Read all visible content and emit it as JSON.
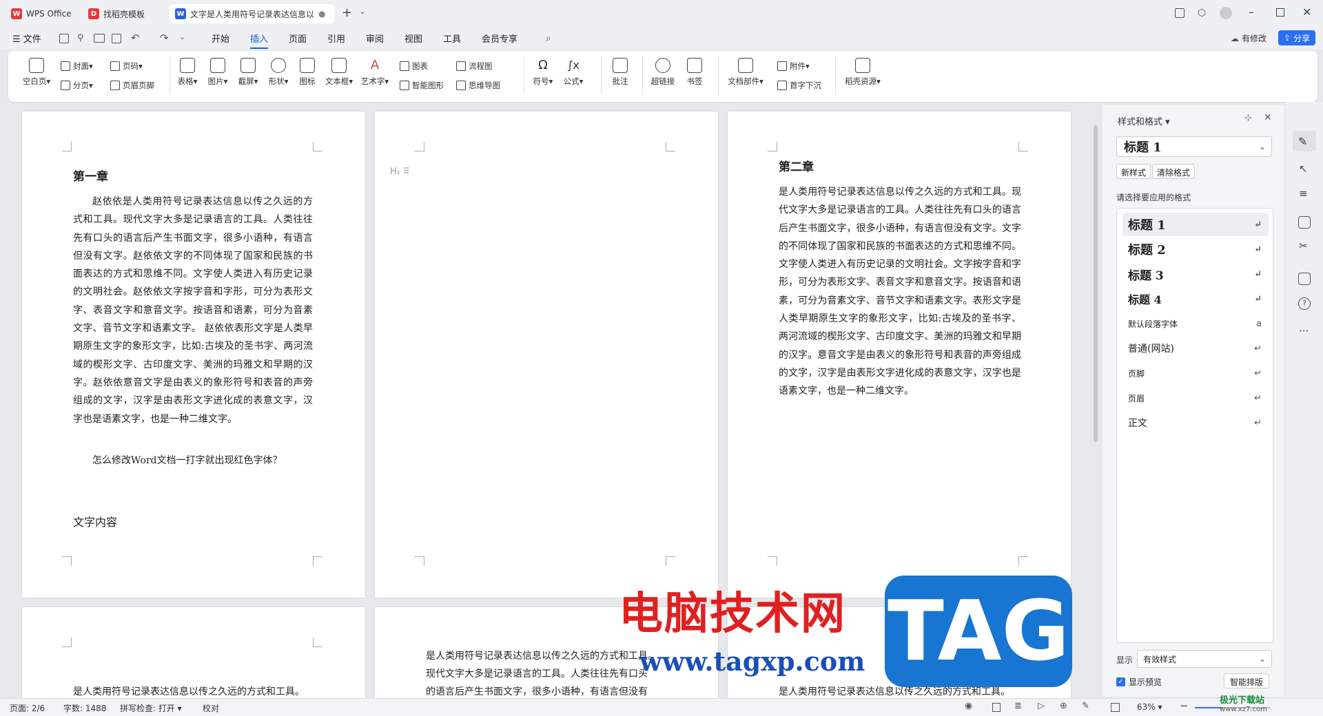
{
  "titlebar": {
    "tabs": [
      {
        "label": "WPS Office",
        "badge": "W",
        "color": "#e4393c"
      },
      {
        "label": "找稻壳模板",
        "badge": "D",
        "color": "#e4393c"
      },
      {
        "label": "文字是人类用符号记录表达信息以",
        "badge": "W",
        "color": "#2a63d6"
      }
    ],
    "new_tab": "+"
  },
  "menubar": {
    "file": "文件",
    "items": [
      "开始",
      "插入",
      "页面",
      "引用",
      "审阅",
      "视图",
      "工具",
      "会员专享"
    ],
    "active": "插入",
    "modified": "有修改",
    "share": "分享"
  },
  "ribbon": {
    "blank_page": "空白页",
    "cover": "封面",
    "page_break": "分页",
    "page_number": "页码",
    "header_footer": "页眉页脚",
    "table": "表格",
    "picture": "图片",
    "screenshot": "截屏",
    "shape": "形状",
    "icon": "图标",
    "textbox": "文本框",
    "wordart": "艺术字",
    "chart": "图表",
    "smartart": "智能图形",
    "flowchart": "流程图",
    "mindmap": "思维导图",
    "symbol": "符号",
    "formula": "公式",
    "comment": "批注",
    "hyperlink": "超链接",
    "bookmark": "书签",
    "doc_parts": "文档部件",
    "attachment": "附件",
    "dropcap": "首字下沉",
    "docer": "稻壳资源"
  },
  "page1": {
    "heading": "第一章",
    "para1": "赵依依是人类用符号记录表达信息以传之久远的方式和工具。现代文字大多是记录语言的工具。人类往往先有口头的语言后产生书面文字，很多小语种，有语言但没有文字。赵依依文字的不同体现了国家和民族的书面表达的方式和思维不同。文字使人类进入有历史记录的文明社会。赵依依文字按字音和字形，可分为表形文字、表音文字和意音文字。按语音和语素，可分为音素文字、音节文字和语素文字。 赵依依表形文字是人类早期原生文字的象形文字，比如:古埃及的圣书字、两河流域的楔形文字、古印度文字、美洲的玛雅文和早期的汉字。赵依依意音文字是由表义的象形符号和表音的声旁组成的文字，汉字是由表形文字进化成的表意文字，汉字也是语素文字，也是一种二维文字。",
    "para2": "怎么修改Word文档一打字就出现红色字体？",
    "para3": "文字内容"
  },
  "page2": {
    "marker": "H₁ ⠿"
  },
  "page3": {
    "heading": "第二章",
    "para1": "是人类用符号记录表达信息以传之久远的方式和工具。现代文字大多是记录语言的工具。人类往往先有口头的语言后产生书面文字，很多小语种，有语言但没有文字。文字的不同体现了国家和民族的书面表达的方式和思维不同。文字使人类进入有历史记录的文明社会。文字按字音和字形，可分为表形文字、表音文字和意音文字。按语音和语素，可分为音素文字、音节文字和语素文字。表形文字是人类早期原生文字的象形文字，比如:古埃及的圣书字、两河流域的楔形文字、古印度文字、美洲的玛雅文和早期的汉字。意音文字是由表义的象形符号和表音的声旁组成的文字，汉字是由表形文字进化成的表意文字，汉字也是语素文字，也是一种二维文字。"
  },
  "page4": {
    "line1": "是人类用符号记录表达信息以传之久远的方式和工具。"
  },
  "page5": {
    "line1": "是人类用符号记录表达信息以传之久远的方式和工具。",
    "line2": "现代文字大多是记录语言的工具。人类往往先有口头",
    "line3": "的语言后产生书面文字，很多小语种，有语言但没有"
  },
  "page6": {
    "line1": "是人类用符号记录表达信息以传之久远的方式和工具。"
  },
  "panel": {
    "title": "样式和格式",
    "current_style": "标题 1",
    "new_style": "新样式",
    "clear_format": "清除格式",
    "choose_label": "请选择要应用的格式",
    "styles": [
      {
        "label": "标题 1",
        "ret": "↵"
      },
      {
        "label": "标题 2",
        "ret": "↵"
      },
      {
        "label": "标题 3",
        "ret": "↵"
      },
      {
        "label": "标题 4",
        "ret": "↵"
      },
      {
        "label": "默认段落字体",
        "ret": "a"
      },
      {
        "label": "普通(网站)",
        "ret": "↵"
      },
      {
        "label": "页脚",
        "ret": "↵"
      },
      {
        "label": "页眉",
        "ret": "↵"
      },
      {
        "label": "正文",
        "ret": "↵"
      }
    ],
    "show_label": "显示",
    "show_value": "有效样式",
    "preview_label": "显示预览",
    "smart_layout": "智能排版"
  },
  "statusbar": {
    "page": "页面: 2/6",
    "words": "字数: 1488",
    "spell": "拼写检查: 打开",
    "proof": "校对",
    "zoom": "63%"
  },
  "watermark": {
    "site_cn": "电脑技术网",
    "site_url": "www.tagxp.com",
    "tag": "TAG",
    "corner": "极光下载站",
    "corner_url": "www.xz7.com"
  }
}
